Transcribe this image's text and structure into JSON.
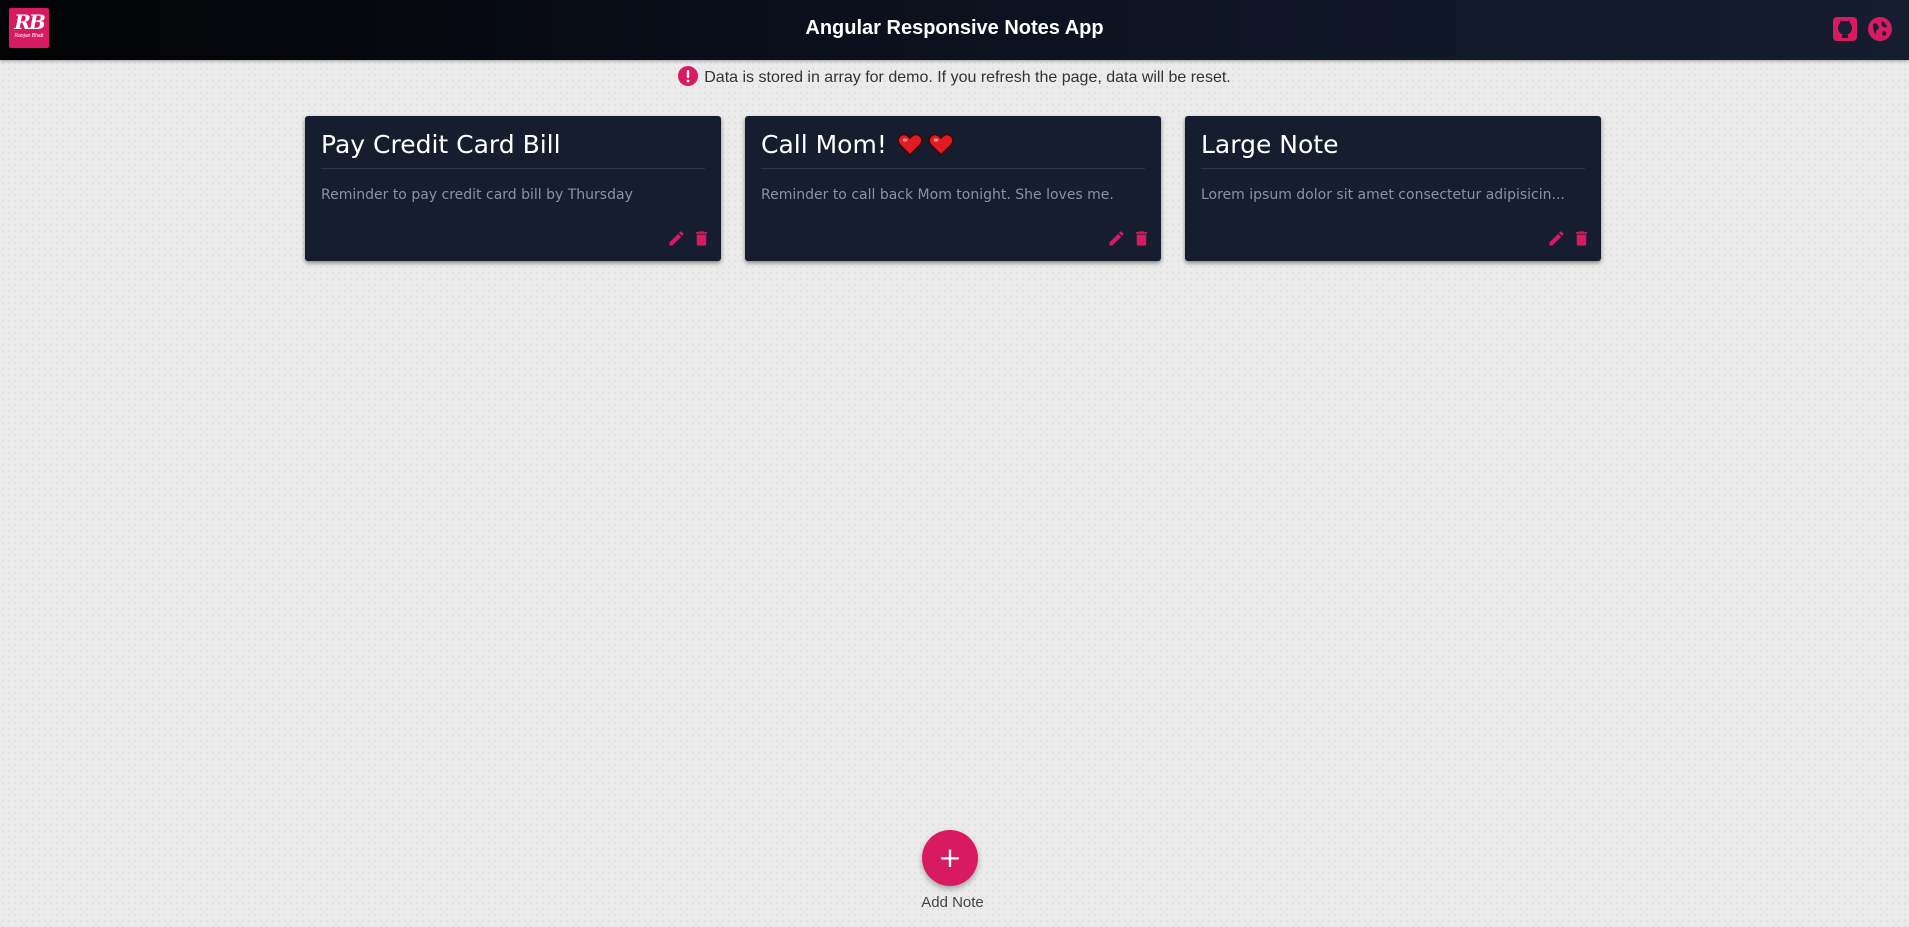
{
  "header": {
    "logo_text": "RB",
    "logo_subtext": "Ranjan Bhatt",
    "title": "Angular Responsive Notes App",
    "icons": [
      "github-icon",
      "globe-icon"
    ]
  },
  "info": {
    "icon": "alert-icon",
    "message": "Data is stored in array for demo. If you refresh the page, data will be reset."
  },
  "notes": [
    {
      "title": "Pay Credit Card Bill",
      "description": "Reminder to pay credit card bill by Thursday",
      "hearts": 0
    },
    {
      "title": "Call Mom!",
      "description": "Reminder to call back Mom tonight. She loves me.",
      "hearts": 2
    },
    {
      "title": "Large Note",
      "description": "Lorem ipsum dolor sit amet consectetur adipisicin...",
      "hearts": 0
    }
  ],
  "note_actions": [
    "edit-icon",
    "delete-icon"
  ],
  "fab": {
    "symbol": "+",
    "label": "Add Note"
  },
  "colors": {
    "accent": "#d81b60",
    "card_bg": "#161d2f",
    "header_bg": "#0b101c",
    "page_bg": "#ebebeb"
  }
}
